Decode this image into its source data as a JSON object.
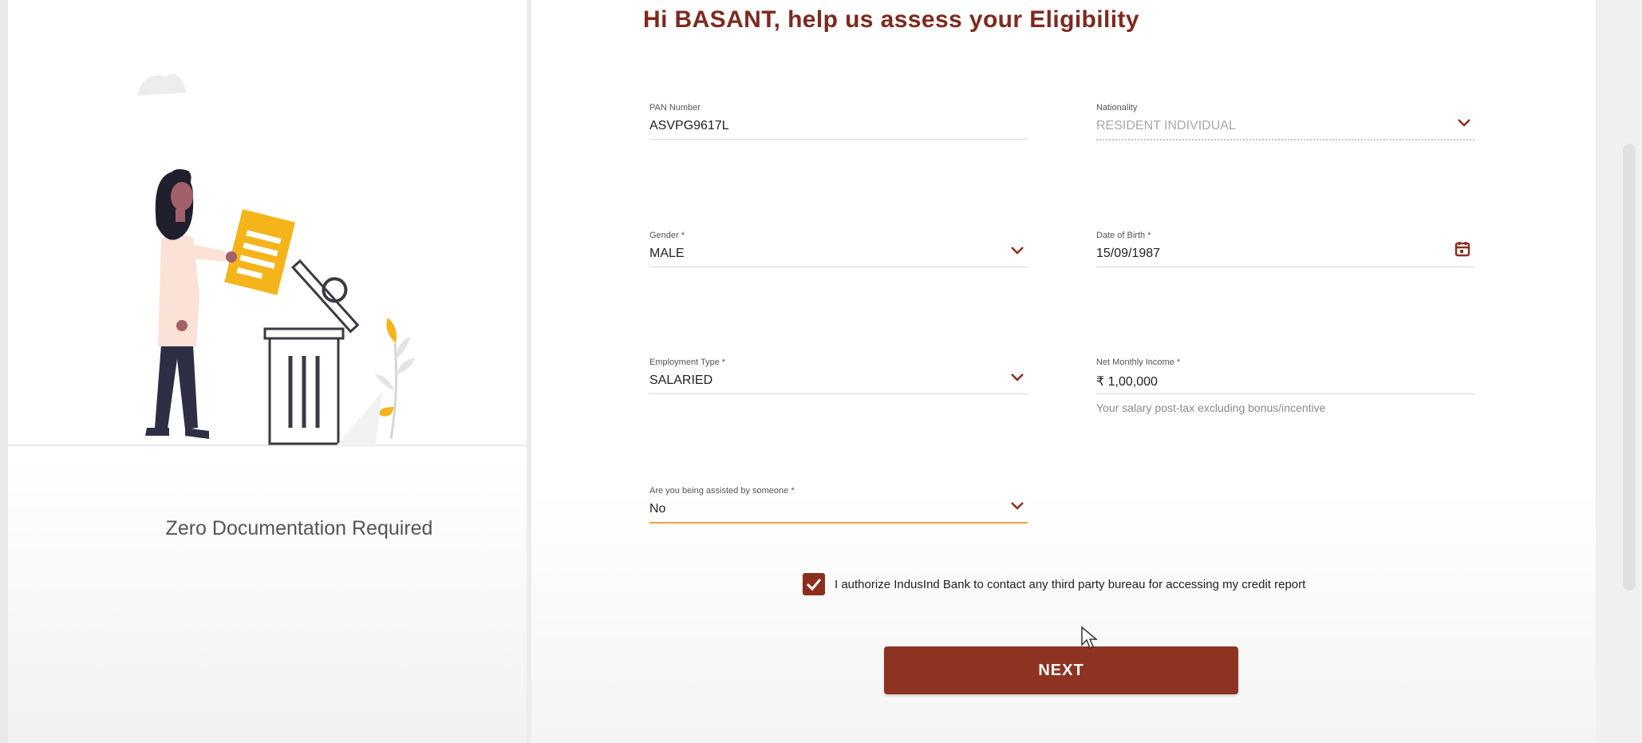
{
  "left_panel": {
    "caption": "Zero Documentation Required"
  },
  "form": {
    "title": "Hi BASANT, help us assess your Eligibility",
    "pan": {
      "label": "PAN Number",
      "value": "ASVPG9617L"
    },
    "nationality": {
      "label": "Nationality",
      "value": "RESIDENT INDIVIDUAL"
    },
    "gender": {
      "label": "Gender *",
      "value": "MALE"
    },
    "dob": {
      "label": "Date of Birth *",
      "value": "15/09/1987"
    },
    "employment_type": {
      "label": "Employment Type *",
      "value": "SALARIED"
    },
    "net_monthly_income": {
      "label": "Net Monthly Income *",
      "currency": "₹",
      "value": "1,00,000",
      "hint": "Your salary post-tax excluding bonus/incentive"
    },
    "assisted": {
      "label": "Are you being assisted by someone *",
      "value": "No"
    },
    "consent": {
      "checked": true,
      "text": "I authorize IndusInd Bank to contact any third party bureau for accessing my credit report"
    },
    "next_label": "NEXT"
  },
  "colors": {
    "brand": "#8e3322",
    "title": "#7d2a1e",
    "accent_focus": "#e2a73b",
    "illustration_yellow": "#f4b41a"
  },
  "icons": {
    "dropdown": "chevron-down-icon",
    "calendar": "calendar-icon",
    "check": "check-icon"
  }
}
